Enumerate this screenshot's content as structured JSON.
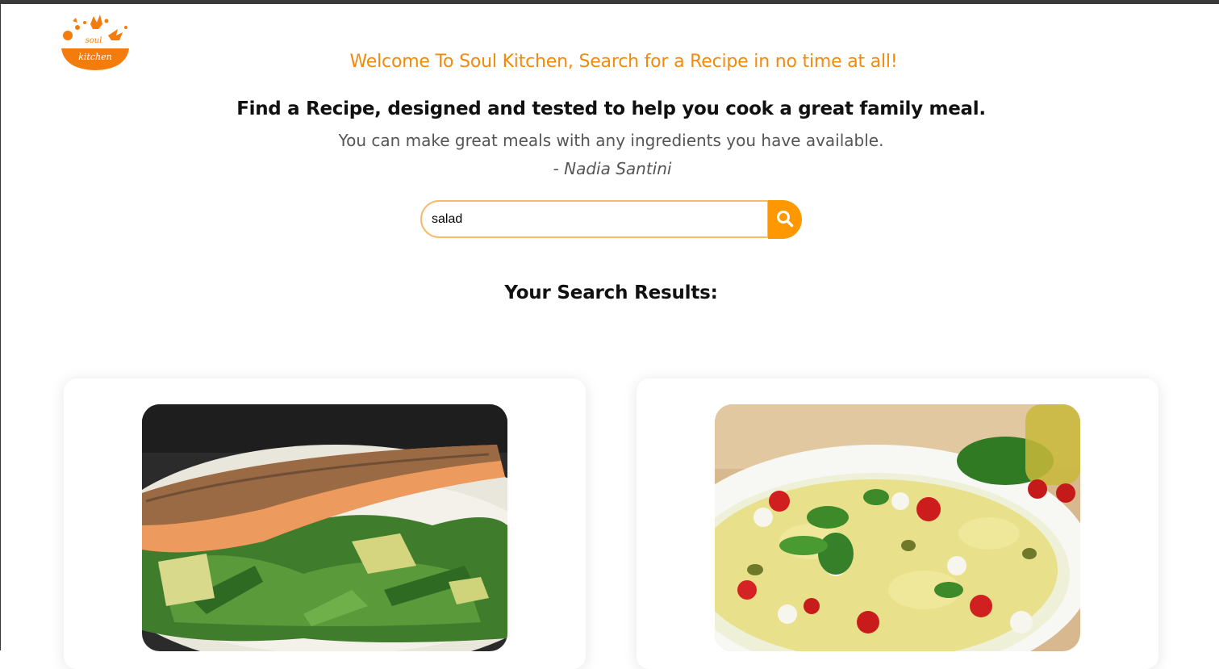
{
  "header": {
    "logo_text_top": "soul",
    "logo_text_bottom": "kitchen",
    "welcome": "Welcome To Soul Kitchen, Search for a Recipe in no time at all!",
    "headline": "Find a Recipe, designed and tested to help you cook a great family meal.",
    "subtext": "You can make great meals with any ingredients you have available.",
    "author": "- Nadia Santini"
  },
  "search": {
    "value": "salad",
    "button_icon": "search-icon"
  },
  "results": {
    "title": "Your Search Results:",
    "cards": [
      {
        "image": "salmon-salad-photo"
      },
      {
        "image": "pasta-salad-photo"
      }
    ]
  },
  "colors": {
    "accent": "#ff9800",
    "welcome_text": "#f28a0c",
    "input_border": "#f7b96a"
  }
}
